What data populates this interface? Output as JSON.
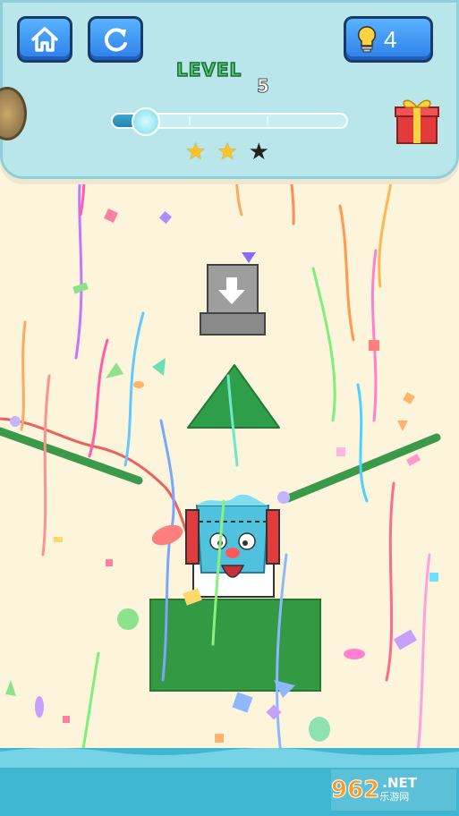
{
  "hud": {
    "level_label": "LEVEL",
    "level_number": "5",
    "hint_count": "4",
    "stars_earned": 2,
    "stars_total": 3,
    "progress_fraction": 0.14
  },
  "icons": {
    "home": "home-icon",
    "restart": "restart-icon",
    "hint": "lightbulb-icon",
    "gift": "gift-icon",
    "star_filled": "star-filled-icon",
    "star_empty": "star-empty-icon"
  },
  "colors": {
    "background": "#fdf4dc",
    "panel": "#b9e6ea",
    "button": "#3a92f2",
    "green": "#3a9a4a",
    "water": "#3fb6d2",
    "drawn_line": "#e8524e"
  },
  "watermark": {
    "main": "962",
    "suffix": ".NET",
    "sub": "乐游网"
  }
}
